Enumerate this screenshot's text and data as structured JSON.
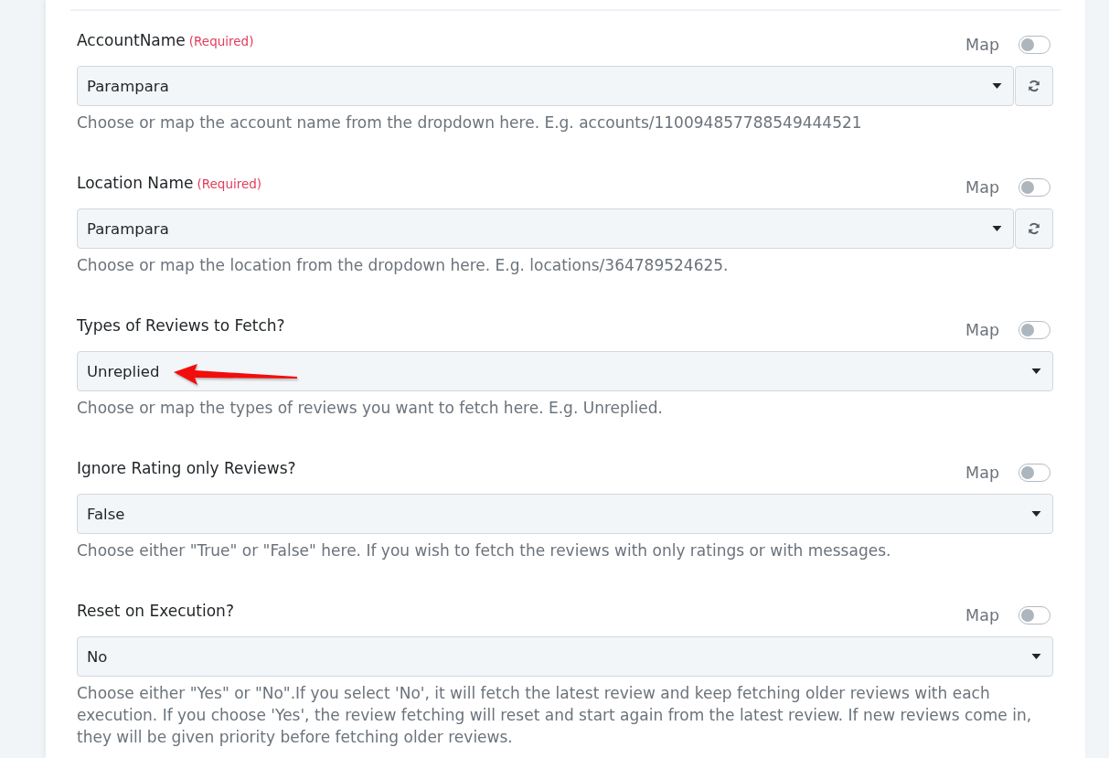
{
  "fields": [
    {
      "label": "AccountName",
      "required_note": "(Required)",
      "map_label": "Map",
      "map_enabled": false,
      "value": "Parampara",
      "refresh_button": true,
      "arrow_marker": false,
      "help": "Choose or map the account name from the dropdown here. E.g. accounts/110094857788549444521"
    },
    {
      "label": "Location Name",
      "required_note": "(Required)",
      "map_label": "Map",
      "map_enabled": false,
      "value": "Parampara",
      "refresh_button": true,
      "arrow_marker": false,
      "help": "Choose or map the location from the dropdown here. E.g. locations/364789524625."
    },
    {
      "label": "Types of Reviews to Fetch?",
      "map_label": "Map",
      "map_enabled": false,
      "value": "Unreplied",
      "refresh_button": false,
      "arrow_marker": true,
      "help": "Choose or map the types of reviews you want to fetch here. E.g. Unreplied."
    },
    {
      "label": "Ignore Rating only Reviews?",
      "map_label": "Map",
      "map_enabled": false,
      "value": "False",
      "refresh_button": false,
      "arrow_marker": false,
      "help": "Choose either \"True\" or \"False\" here. If you wish to fetch the reviews with only ratings or with messages."
    },
    {
      "label": "Reset on Execution?",
      "map_label": "Map",
      "map_enabled": false,
      "value": "No",
      "refresh_button": false,
      "arrow_marker": false,
      "help": "Choose either \"Yes\" or \"No\".If you select 'No', it will fetch the latest review and keep fetching older reviews with each execution. If you choose 'Yes', the review fetching will reset and start again from the latest review. If new reviews come in, they will be given priority before fetching older reviews."
    }
  ]
}
